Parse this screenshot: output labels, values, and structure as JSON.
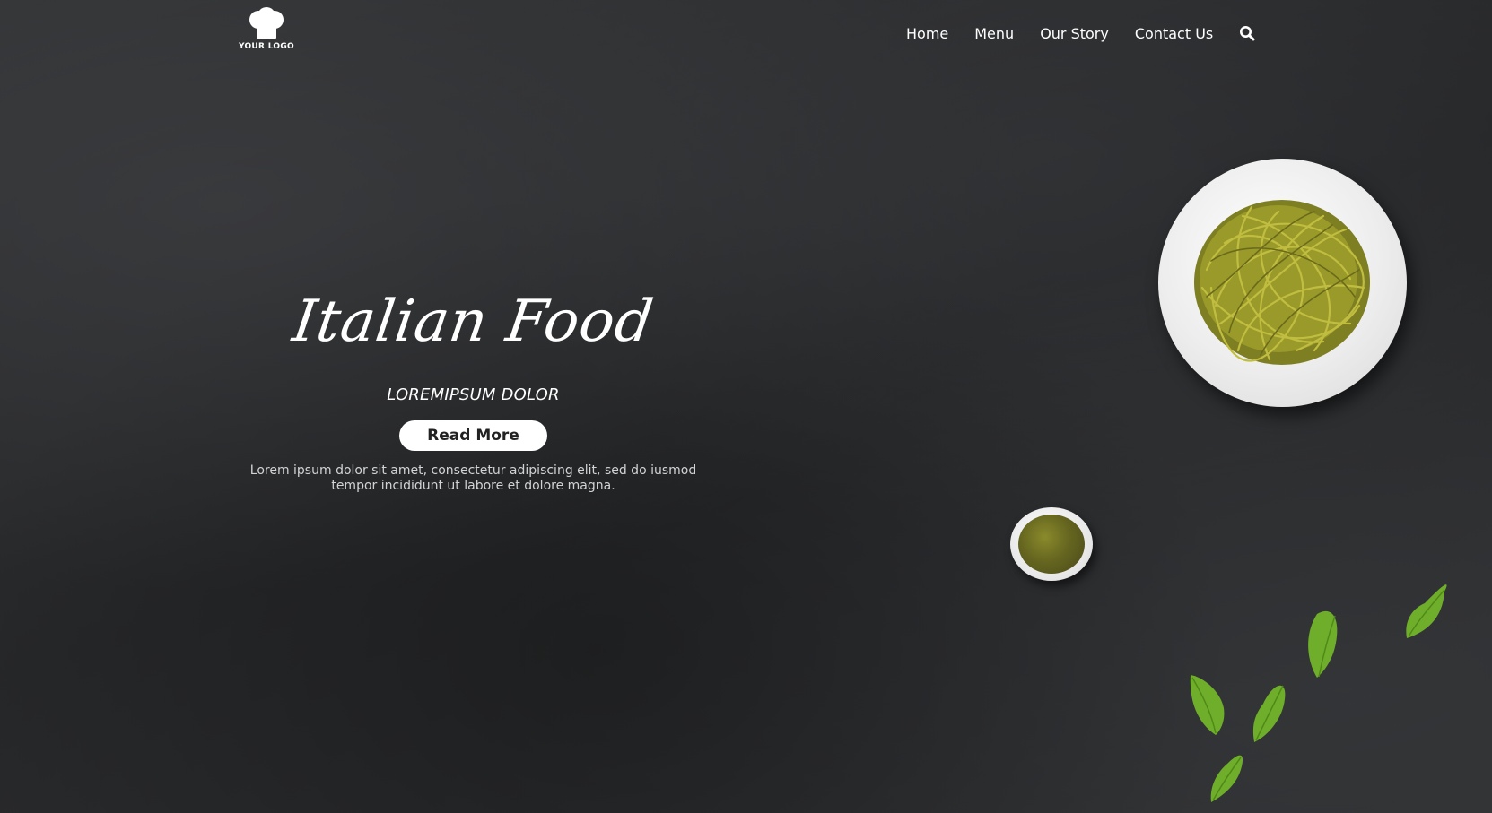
{
  "header": {
    "logo_text": "YOUR LOGO",
    "logo_icon": "chef-hat-icon",
    "nav": [
      {
        "label": "Home"
      },
      {
        "label": "Menu"
      },
      {
        "label": "Our Story"
      },
      {
        "label": "Contact Us"
      }
    ],
    "search_icon": "search-icon"
  },
  "hero": {
    "title": "Italian Food",
    "subtitle": "LOREMIPSUM DOLOR",
    "button_label": "Read More",
    "description": "Lorem ipsum dolor sit amet, consectetur adipiscing elit, sed do iusmod tempor incididunt ut labore et dolore magna."
  },
  "colors": {
    "background": "#2b2c2e",
    "text": "#ffffff",
    "button_bg": "#ffffff",
    "button_text": "#222222",
    "pasta": "#9a9a2a",
    "basil": "#6fae2a"
  }
}
